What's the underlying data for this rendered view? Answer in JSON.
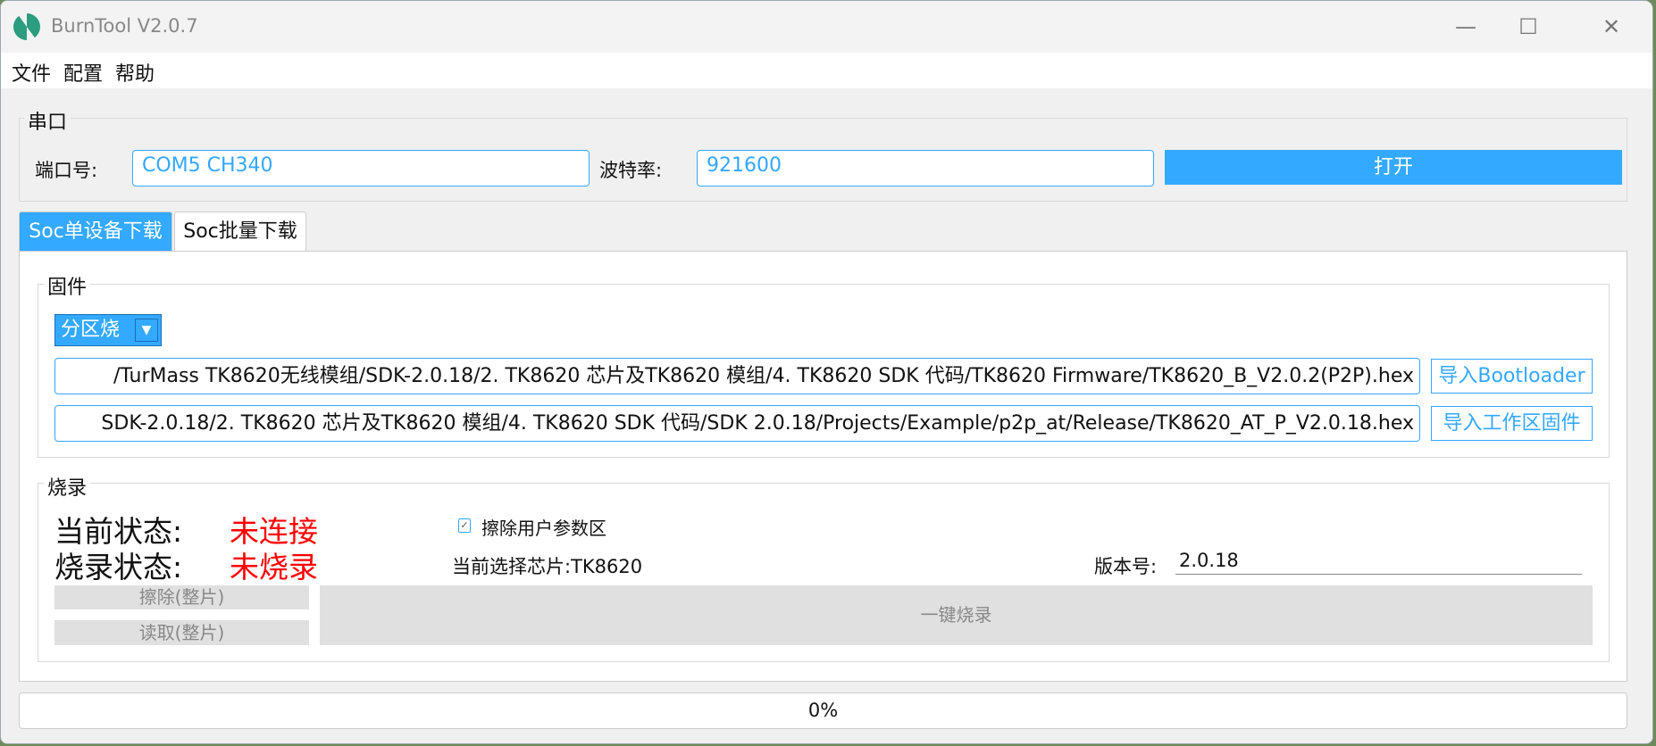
{
  "window": {
    "title": "BurnTool V2.0.7",
    "minimize": "—",
    "maximize": "☐",
    "close": "✕"
  },
  "menu": [
    "文件",
    "配置",
    "帮助"
  ],
  "serial": {
    "group_label": "串口",
    "port_label": "端口号:",
    "port_value": "COM5  CH340",
    "baud_label": "波特率:",
    "baud_value": "921600",
    "open_button": "打开"
  },
  "tabs": [
    {
      "label": "Soc单设备下载",
      "active": true
    },
    {
      "label": "Soc批量下载",
      "active": false
    }
  ],
  "firmware": {
    "group_label": "固件",
    "mode_select": "分区烧",
    "bootloader_path": "/TurMass TK8620无线模组/SDK-2.0.18/2. TK8620 芯片及TK8620 模组/4. TK8620 SDK 代码/TK8620 Firmware/TK8620_B_V2.0.2(P2P).hex",
    "bootloader_button": "导入Bootloader",
    "app_path": "SDK-2.0.18/2. TK8620 芯片及TK8620 模组/4. TK8620 SDK 代码/SDK 2.0.18/Projects/Example/p2p_at/Release/TK8620_AT_P_V2.0.18.hex",
    "app_button": "导入工作区固件"
  },
  "burn": {
    "group_label": "烧录",
    "current_status_label": "当前状态:",
    "current_status_value": "未连接",
    "burn_status_label": "烧录状态:",
    "burn_status_value": "未烧录",
    "erase_user_checkbox": "擦除用户参数区",
    "erase_user_checked": true,
    "chip_text": "当前选择芯片:TK8620",
    "version_label": "版本号:",
    "version_value": "2.0.18",
    "erase_button": "擦除(整片)",
    "read_button": "读取(整片)",
    "burn_button": "一键烧录",
    "status_color": "#ff0000"
  },
  "progress": {
    "text": "0%",
    "value": 0
  }
}
